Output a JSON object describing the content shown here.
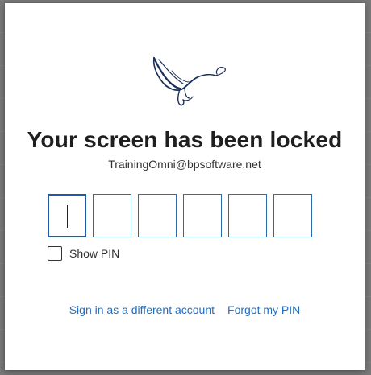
{
  "dialog": {
    "title": "Your screen has been locked",
    "account": "TrainingOmni@bpsoftware.net"
  },
  "pin": {
    "length": 6,
    "show_pin_label": "Show PIN",
    "show_pin_checked": false
  },
  "links": {
    "different_account": "Sign in as a different account",
    "forgot_pin": "Forgot my PIN"
  },
  "colors": {
    "accent": "#1f6fc5",
    "title": "#1f1f1f",
    "logo": "#1a2f5a"
  }
}
